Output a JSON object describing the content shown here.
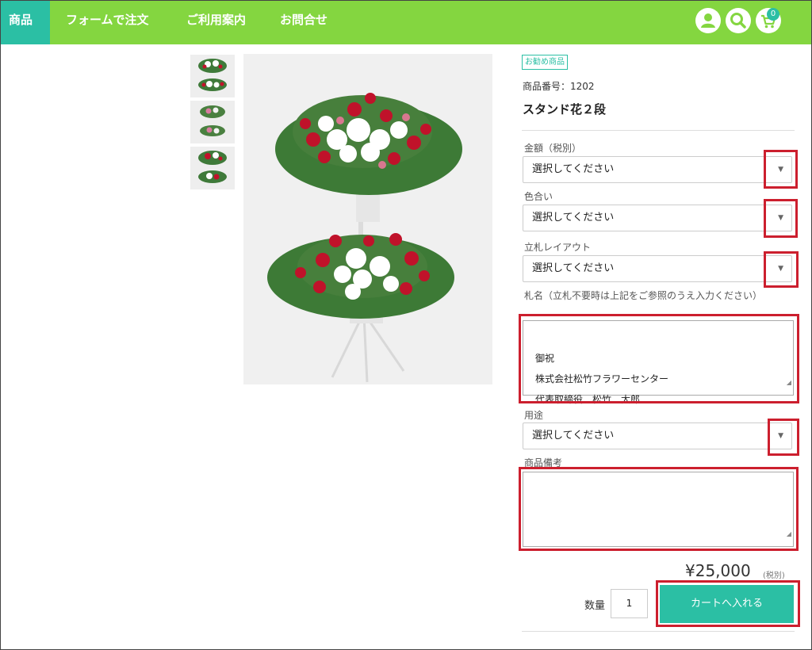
{
  "nav": {
    "items": [
      {
        "label": "商品"
      },
      {
        "label": "フォームで注文"
      },
      {
        "label": "ご利用案内"
      },
      {
        "label": "お問合せ"
      }
    ],
    "cart_count": "0",
    "icons": [
      "user-icon",
      "search-icon",
      "cart-icon"
    ]
  },
  "colors": {
    "nav_bg": "#84d640",
    "accent": "#2bbfa4",
    "highlight_red": "#cc1f2e"
  },
  "product": {
    "badge": "お勧め商品",
    "number": "商品番号：1202",
    "name": "スタンド花２段"
  },
  "form": {
    "price_label": "金額（税別）",
    "price_select": "選択してください",
    "color_label": "色合い",
    "color_select": "選択してください",
    "layout_label": "立札レイアウト",
    "layout_select": "選択してください",
    "fuda_label": "札名（立札不要時は上記をご参照のうえ入力ください）",
    "fuda_text": "御祝\n株式会社松竹フラワーセンター\n代表取締役　松竹　太郎",
    "purpose_label": "用途",
    "purpose_select": "選択してください",
    "remarks_label": "商品備考",
    "remarks_text": ""
  },
  "purchase": {
    "price": "¥25,000",
    "tax_note": "(税別)",
    "qty_label": "数量",
    "qty_value": "1",
    "cart_button": "カートへ入れる"
  }
}
